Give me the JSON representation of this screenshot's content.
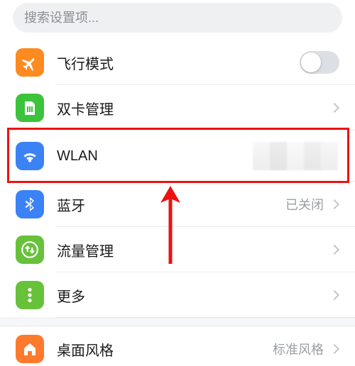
{
  "search": {
    "placeholder": "搜索设置项..."
  },
  "rows": {
    "airplane": {
      "label": "飞行模式",
      "toggle_on": false
    },
    "sim": {
      "label": "双卡管理"
    },
    "wlan": {
      "label": "WLAN"
    },
    "bt": {
      "label": "蓝牙",
      "value": "已关闭"
    },
    "data": {
      "label": "流量管理"
    },
    "more": {
      "label": "更多"
    },
    "desktop": {
      "label": "桌面风格",
      "value": "标准风格"
    }
  },
  "annotation": {
    "highlight_row": "wlan",
    "arrow_color": "#e11"
  }
}
